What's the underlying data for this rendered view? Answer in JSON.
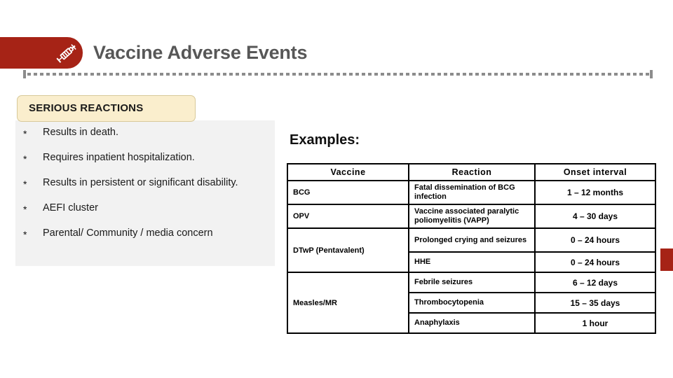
{
  "header": {
    "title": "Vaccine Adverse Events",
    "badge_icon": "syringe-icon",
    "badge_color": "#a62316",
    "title_color": "#575757"
  },
  "left": {
    "callout": {
      "label": "SERIOUS REACTIONS",
      "background": "#faeecd",
      "border_color": "#d8c99a"
    },
    "panel_background": "#f2f2f2",
    "bullet_marker": "*",
    "bullets": [
      "Results in death.",
      "Requires inpatient hospitalization.",
      "Results in persistent or significant disability.",
      "AEFI cluster",
      "Parental/ Community / media concern"
    ]
  },
  "right": {
    "examples_label": "Examples:",
    "table": {
      "columns": [
        "Vaccine",
        "Reaction",
        "Onset interval"
      ],
      "rows": [
        {
          "vaccine": "BCG",
          "vaccine_rowspan": 1,
          "reaction": "Fatal dissemination of BCG infection",
          "onset": "1 – 12 months"
        },
        {
          "vaccine": "OPV",
          "vaccine_rowspan": 1,
          "reaction": "Vaccine associated paralytic poliomyelitis (VAPP)",
          "onset": "4 – 30 days"
        },
        {
          "vaccine": "DTwP (Pentavalent)",
          "vaccine_rowspan": 2,
          "reaction": "Prolonged crying and seizures",
          "onset": "0 – 24 hours"
        },
        {
          "vaccine": null,
          "vaccine_rowspan": 0,
          "reaction": "HHE",
          "onset": "0 – 24 hours"
        },
        {
          "vaccine": "Measles/MR",
          "vaccine_rowspan": 3,
          "reaction": "Febrile seizures",
          "onset": "6 – 12 days"
        },
        {
          "vaccine": null,
          "vaccine_rowspan": 0,
          "reaction": "Thrombocytopenia",
          "onset": "15 – 35 days"
        },
        {
          "vaccine": null,
          "vaccine_rowspan": 0,
          "reaction": "Anaphylaxis",
          "onset": "1 hour"
        }
      ]
    }
  },
  "decor": {
    "divider_color": "#8c8c8c",
    "accent_color": "#a62316"
  }
}
